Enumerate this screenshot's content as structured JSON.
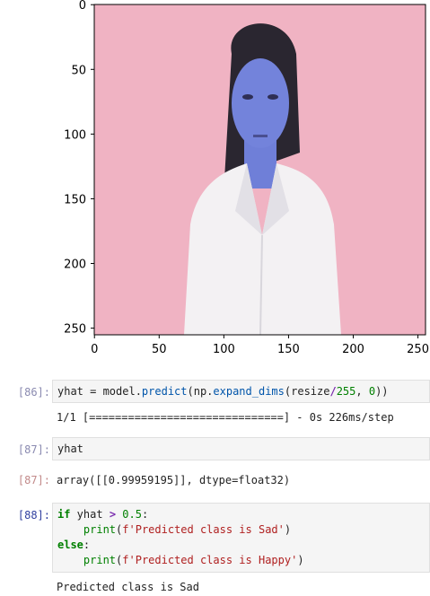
{
  "figure": {
    "xticks": [
      "0",
      "50",
      "100",
      "150",
      "200",
      "250"
    ],
    "yticks": [
      "0",
      "50",
      "100",
      "150",
      "200",
      "250"
    ],
    "image": {
      "subject": "woman-portrait-blue-tinted",
      "background_color": "#f0b3c3",
      "skin_color": "#6f7fd8",
      "hair_color": "#2a2630",
      "shirt_color": "#f3f1f3"
    }
  },
  "cells": [
    {
      "prompt": "[86]:",
      "code": {
        "a": "yhat = model.",
        "b": "predict",
        "c": "(np.",
        "d": "expand_dims",
        "e": "(resize",
        "f": "/",
        "g": "255",
        "h": ", ",
        "i": "0",
        "j": "))"
      },
      "output": "1/1 [==============================] - 0s 226ms/step"
    },
    {
      "prompt": "[87]:",
      "code_text": "yhat",
      "out_prompt": "[87]:",
      "output": "array([[0.99959195]], dtype=float32)"
    },
    {
      "prompt": "[88]:",
      "lines": {
        "l1_kw": "if",
        "l1_a": " yhat ",
        "l1_op": ">",
        "l1_b": " ",
        "l1_num": "0.5",
        "l1_c": ":",
        "l2_indent": "    ",
        "l2_fn": "print",
        "l2_a": "(",
        "l2_str": "f'Predicted class is Sad'",
        "l2_b": ")",
        "l3_kw": "else",
        "l3_a": ":",
        "l4_indent": "    ",
        "l4_fn": "print",
        "l4_a": "(",
        "l4_str": "f'Predicted class is Happy'",
        "l4_b": ")"
      },
      "output": "Predicted class is Sad"
    }
  ]
}
